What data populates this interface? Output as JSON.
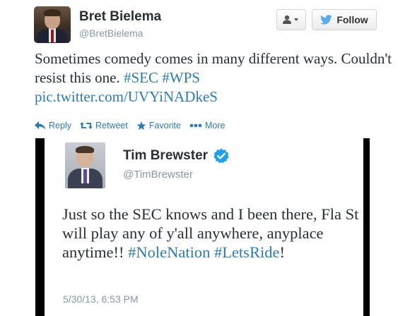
{
  "tweet": {
    "author_name": "Bret Bielema",
    "author_handle": "@BretBielema",
    "text_plain": "Sometimes comedy comes in many different ways. Couldn't resist this one. ",
    "hashtag_1": "#SEC",
    "hashtag_2": "#WPS",
    "pic_link": "pic.twitter.com/UVYiNADkeS"
  },
  "header_buttons": {
    "user_dropdown_icon": "user-dropdown-icon",
    "follow_label": "Follow"
  },
  "actions": {
    "reply_label": "Reply",
    "retweet_label": "Retweet",
    "favorite_label": "Favorite",
    "more_label": "More"
  },
  "embedded_tweet": {
    "author_name": "Tim Brewster",
    "author_handle": "@TimBrewster",
    "verified_icon": "verified-badge-icon",
    "text_plain": "Just so the SEC knows and I been there, Fla St will play any of y'all anywhere, anyplace anytime!! ",
    "hashtag_1": "#NoleNation",
    "hashtag_2": "#LetsRide",
    "text_end": "!",
    "timestamp": "5/30/13, 6:53 PM"
  },
  "colors": {
    "link": "#2b7bb9",
    "name": "#292f33",
    "muted": "#8899a6",
    "follow_bird": "#55acee",
    "verified": "#1da1f2"
  }
}
